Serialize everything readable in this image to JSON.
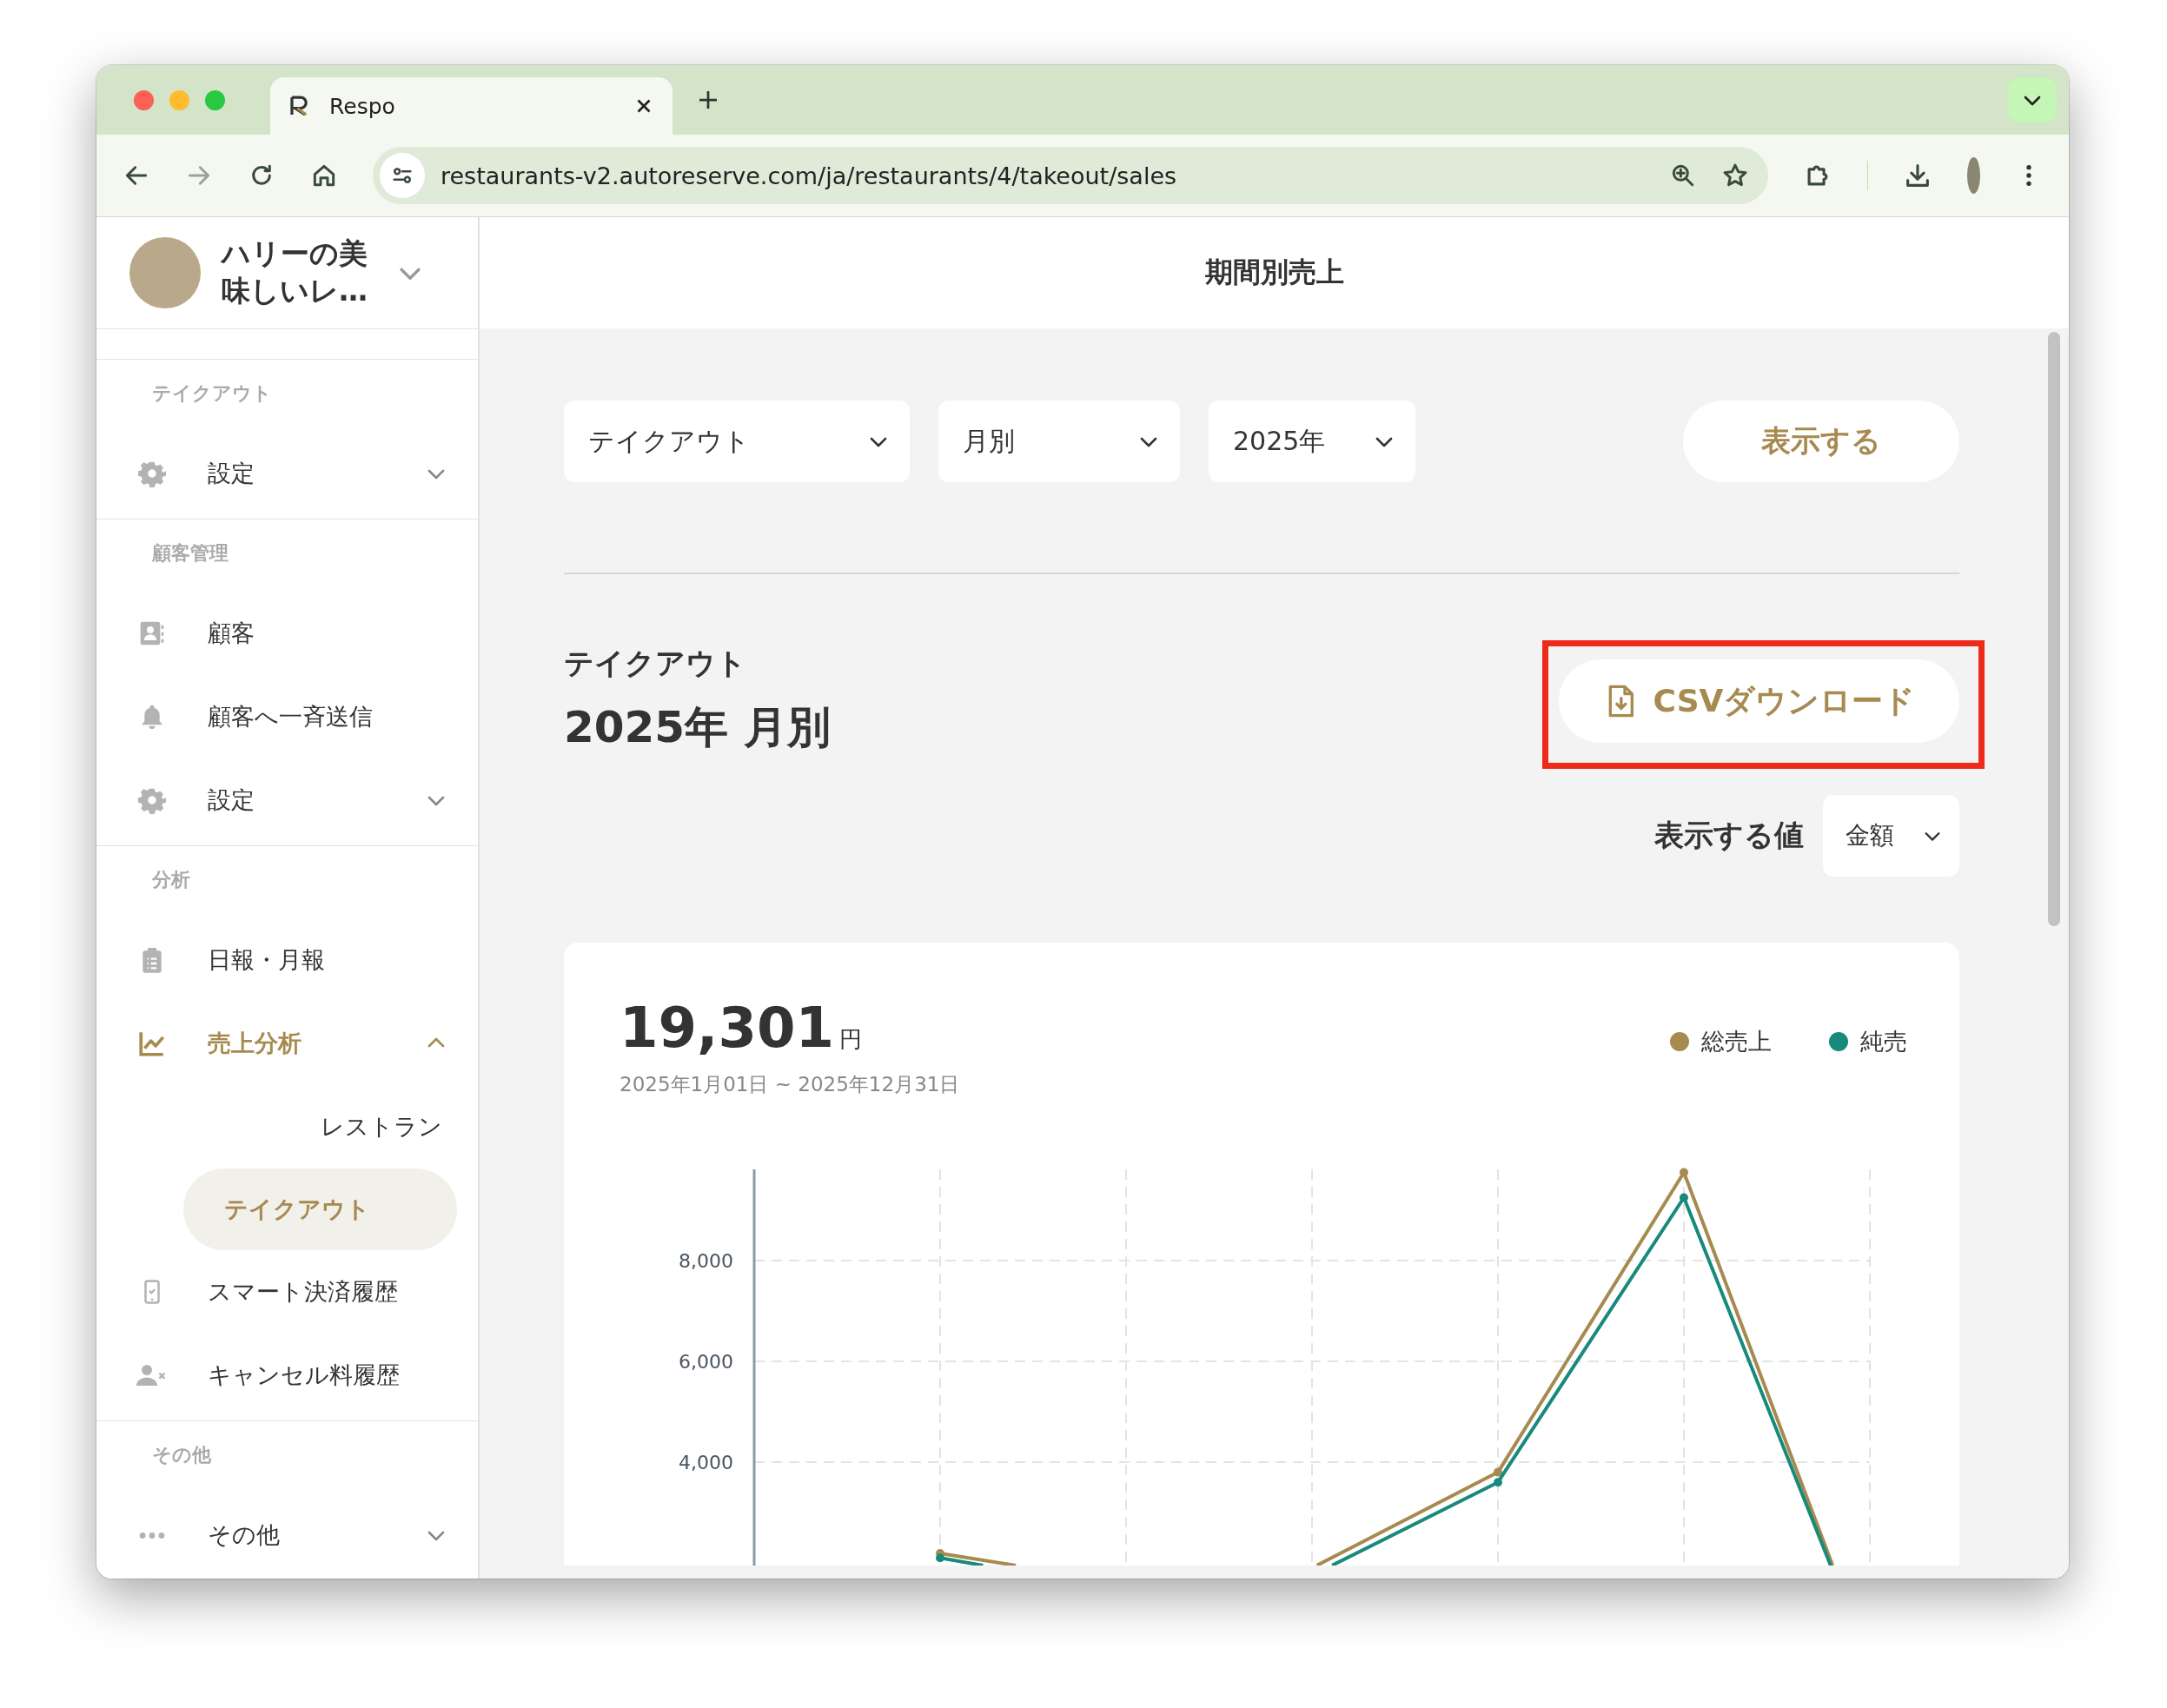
{
  "browser": {
    "tab_title": "Respo",
    "url": "restaurants-v2.autoreserve.com/ja/restaurants/4/takeout/sales"
  },
  "sidebar": {
    "store_name": "ハリーの美味しいレ…",
    "sections": [
      {
        "label": "テイクアウト",
        "items": [
          {
            "label": "設定",
            "kind": "group",
            "expanded": false,
            "active": false
          }
        ]
      },
      {
        "label": "顧客管理",
        "items": [
          {
            "label": "顧客",
            "kind": "link",
            "active": false
          },
          {
            "label": "顧客へ一斉送信",
            "kind": "link",
            "active": false
          },
          {
            "label": "設定",
            "kind": "group",
            "expanded": false,
            "active": false
          }
        ]
      },
      {
        "label": "分析",
        "items": [
          {
            "label": "日報・月報",
            "kind": "link",
            "active": false
          },
          {
            "label": "売上分析",
            "kind": "group",
            "expanded": true,
            "active": true,
            "children": [
              {
                "label": "レストラン",
                "selected": false
              },
              {
                "label": "テイクアウト",
                "selected": true
              }
            ]
          },
          {
            "label": "スマート決済履歴",
            "kind": "link",
            "active": false
          },
          {
            "label": "キャンセル料履歴",
            "kind": "link",
            "active": false
          }
        ]
      },
      {
        "label": "その他",
        "items": [
          {
            "label": "その他",
            "kind": "group",
            "expanded": false,
            "active": false
          }
        ]
      }
    ]
  },
  "main": {
    "page_title": "期間別売上",
    "filters": [
      {
        "value": "テイクアウト"
      },
      {
        "value": "月別"
      },
      {
        "value": "2025年"
      }
    ],
    "show_button": "表示する",
    "report": {
      "subtitle": "テイクアウト",
      "title": "2025年 月別",
      "csv_button": "CSVダウンロード",
      "value_selector": {
        "label": "表示する値",
        "value": "金額"
      }
    },
    "card": {
      "total": "19,301",
      "unit": "円",
      "period": "2025年1月01日 ~ 2025年12月31日",
      "legend": [
        {
          "label": "総売上",
          "color": "#a68a4f"
        },
        {
          "label": "純売",
          "color": "#178a7c"
        }
      ],
      "axis_labels": [
        "8,000",
        "6,000",
        "4,000"
      ]
    }
  }
}
